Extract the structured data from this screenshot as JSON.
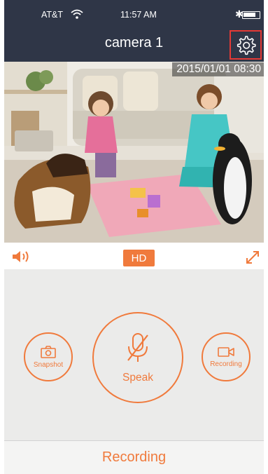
{
  "status_bar": {
    "carrier": "AT&T",
    "time": "11:57 AM",
    "icons": [
      "wifi-icon",
      "bluetooth-icon",
      "battery-icon"
    ]
  },
  "header": {
    "title": "camera 1",
    "settings_icon": "gear-icon"
  },
  "video": {
    "timestamp": "2015/01/01 08:30"
  },
  "controls": {
    "speaker_icon": "speaker-icon",
    "quality_label": "HD",
    "fullscreen_icon": "expand-icon"
  },
  "actions": {
    "snapshot_label": "Snapshot",
    "speak_label": "Speak",
    "recording_label": "Recording"
  },
  "footer": {
    "recording_label": "Recording"
  },
  "colors": {
    "accent": "#f07a3c",
    "header_bg": "#2f3647",
    "panel_bg": "#ebebea",
    "highlight_box": "#e53935"
  }
}
